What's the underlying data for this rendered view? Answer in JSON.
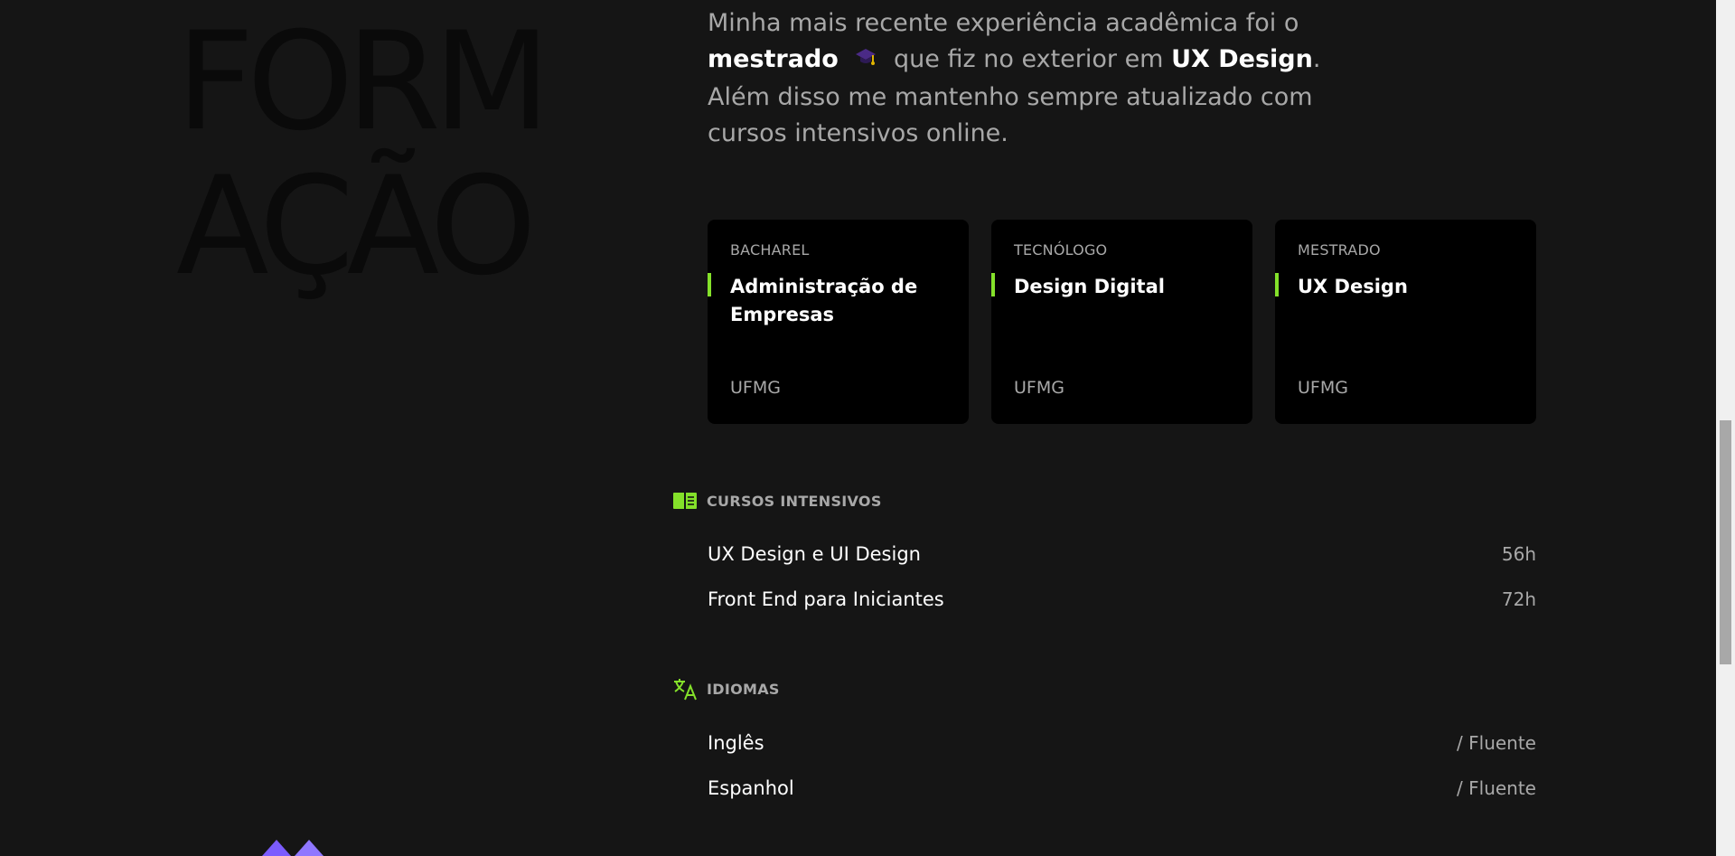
{
  "heading": {
    "line1": "FORM",
    "line2": "AÇÃO"
  },
  "intro": {
    "part1": "Minha mais recente experiência acadêmica foi o",
    "bold1": "mestrado",
    "part2": "que fiz no exterior em",
    "bold2": "UX Design",
    "part3": ".",
    "part4": "Além disso me mantenho sempre atualizado com cursos intensivos online.",
    "emoji_icon": "graduation-cap-icon"
  },
  "cards": [
    {
      "type": "BACHAREL",
      "title": "Administração de Empresas",
      "school": "UFMG"
    },
    {
      "type": "TECNÓLOGO",
      "title": "Design Digital",
      "school": "UFMG"
    },
    {
      "type": "MESTRADO",
      "title": "UX Design",
      "school": "UFMG"
    }
  ],
  "courses": {
    "heading": "CURSOS INTENSIVOS",
    "icon": "book-icon",
    "items": [
      {
        "name": "UX Design e UI Design",
        "hours": "56h"
      },
      {
        "name": "Front End para Iniciantes",
        "hours": "72h"
      }
    ]
  },
  "languages": {
    "heading": "IDIOMAS",
    "icon": "translate-icon",
    "items": [
      {
        "name": "Inglês",
        "level": "/ Fluente"
      },
      {
        "name": "Espanhol",
        "level": "/ Fluente"
      }
    ]
  },
  "colors": {
    "accent": "#84e12a",
    "background": "#151515",
    "card": "#000000",
    "decor": "#7b5cff"
  }
}
